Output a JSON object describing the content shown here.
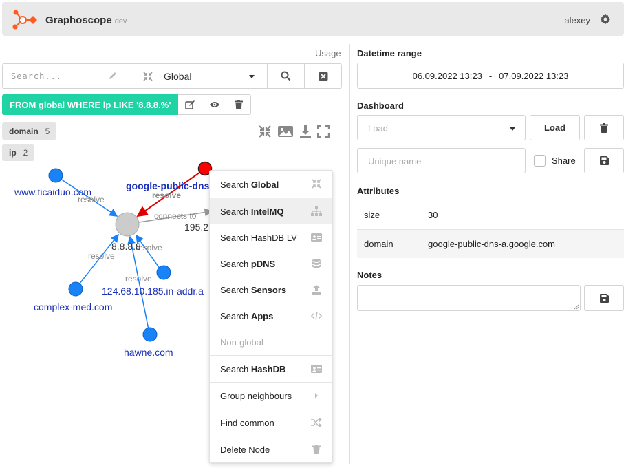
{
  "header": {
    "app_name": "Graphoscope",
    "env": "dev",
    "username": "alexey",
    "icons": [
      "logo-icon",
      "gear-icon"
    ]
  },
  "toolbar": {
    "usage_label": "Usage",
    "search_placeholder": "Search...",
    "scope_value": "Global",
    "icons": [
      "pencil-icon",
      "compress-icon",
      "search-icon",
      "clear-icon"
    ]
  },
  "query": {
    "text": "FROM global WHERE ip LIKE '8.8.8.%'",
    "icons": [
      "edit-icon",
      "eye-icon",
      "trash-icon"
    ]
  },
  "type_tags": [
    {
      "label": "domain",
      "count": "5"
    },
    {
      "label": "ip",
      "count": "2"
    }
  ],
  "graph": {
    "nodes": {
      "ticaiduo": "www.ticaiduo.com",
      "google": "google-public-dns",
      "center": "8.8.8.8",
      "ip195": "195.2",
      "complex": "complex-med.com",
      "inaddr": "124.68.10.185.in-addr.a",
      "hawne": "hawne.com"
    },
    "edges": {
      "resolve": "resolve",
      "connects_to": "connects to"
    },
    "colors": {
      "domain_node": "#1a82f7",
      "selected_node": "#ff0000",
      "ip_node": "#cccccc",
      "edge_blue": "#1a82f7",
      "edge_red": "#e00000",
      "label_blue": "#1a2fb8"
    }
  },
  "context_menu": {
    "items": [
      {
        "prefix": "Search ",
        "bold": "Global",
        "icon": "compress-icon"
      },
      {
        "prefix": "Search ",
        "bold": "IntelMQ",
        "icon": "sitemap-icon"
      },
      {
        "prefix": "Search HashDB LV",
        "bold": "",
        "icon": "id-card-icon"
      },
      {
        "prefix": "Search ",
        "bold": "pDNS",
        "icon": "database-icon"
      },
      {
        "prefix": "Search ",
        "bold": "Sensors",
        "icon": "upload-icon"
      },
      {
        "prefix": "Search ",
        "bold": "Apps",
        "icon": "code-icon"
      },
      {
        "prefix": "Non-global",
        "bold": "",
        "icon": ""
      },
      {
        "prefix": "Search ",
        "bold": "HashDB",
        "icon": "id-card-icon"
      },
      {
        "prefix": "Group neighbours",
        "bold": "",
        "icon": "chevron-right-icon"
      },
      {
        "prefix": "Find common",
        "bold": "",
        "icon": "shuffle-icon"
      },
      {
        "prefix": "Delete Node",
        "bold": "",
        "icon": "trash-icon"
      }
    ]
  },
  "right": {
    "datetime_label": "Datetime range",
    "date_from": "06.09.2022 13:23",
    "date_sep": "-",
    "date_to": "07.09.2022 13:23",
    "dashboard_label": "Dashboard",
    "load_placeholder": "Load",
    "load_button": "Load",
    "unique_name_placeholder": "Unique name",
    "share_label": "Share",
    "attributes_label": "Attributes",
    "attributes": [
      {
        "key": "size",
        "value": "30"
      },
      {
        "key": "domain",
        "value": "google-public-dns-a.google.com"
      }
    ],
    "notes_label": "Notes"
  }
}
